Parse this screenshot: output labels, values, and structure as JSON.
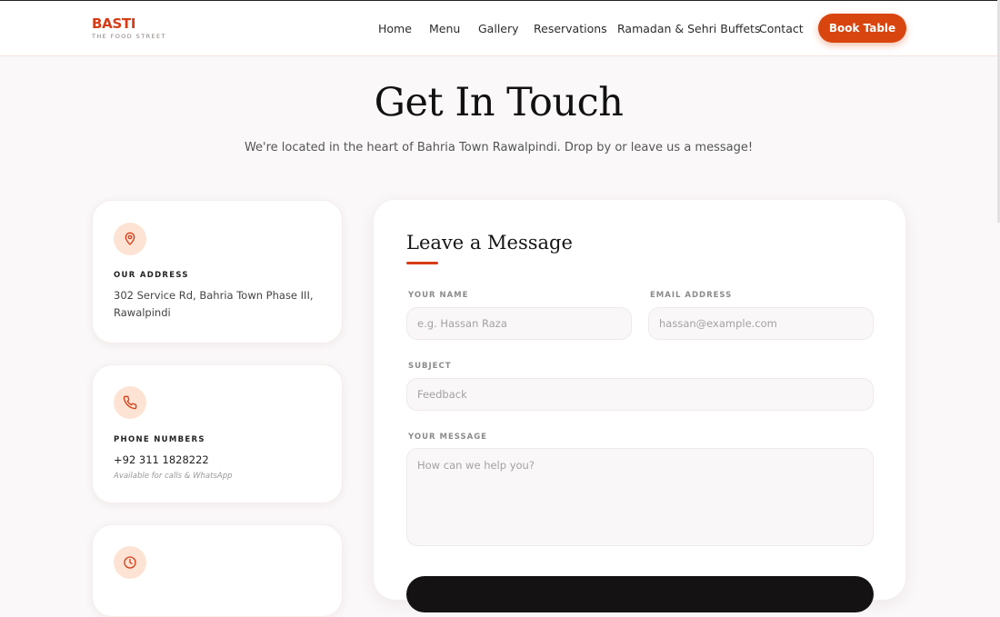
{
  "brand": {
    "name": "BASTI",
    "tagline": "THE FOOD STREET"
  },
  "nav": {
    "items": [
      "Home",
      "Menu",
      "Gallery",
      "Reservations",
      "Ramadan & Sehri Buffets",
      "Contact"
    ],
    "cta": "Book Table"
  },
  "hero": {
    "title": "Get In Touch",
    "subtitle": "We're located in the heart of Bahria Town Rawalpindi. Drop by or leave us a message!"
  },
  "info": {
    "address": {
      "label": "OUR ADDRESS",
      "line1": "302 Service Rd, Bahria Town Phase III,",
      "line2": "Rawalpindi",
      "icon": "map-pin-icon"
    },
    "phone": {
      "label": "PHONE NUMBERS",
      "value": "+92 311 1828222",
      "note": "Available for calls & WhatsApp",
      "icon": "phone-icon"
    },
    "hours": {
      "icon": "clock-icon"
    }
  },
  "form": {
    "title": "Leave a Message",
    "name": {
      "label": "YOUR NAME",
      "placeholder": "e.g. Hassan Raza"
    },
    "email": {
      "label": "EMAIL ADDRESS",
      "placeholder": "hassan@example.com"
    },
    "subject": {
      "label": "SUBJECT",
      "placeholder": "Feedback"
    },
    "message": {
      "label": "YOUR MESSAGE",
      "placeholder": "How can we help you?"
    }
  },
  "colors": {
    "accent": "#d9450f",
    "brand": "#d63c16",
    "icon_bg": "#fde3d3",
    "background": "#fbf8f9"
  }
}
